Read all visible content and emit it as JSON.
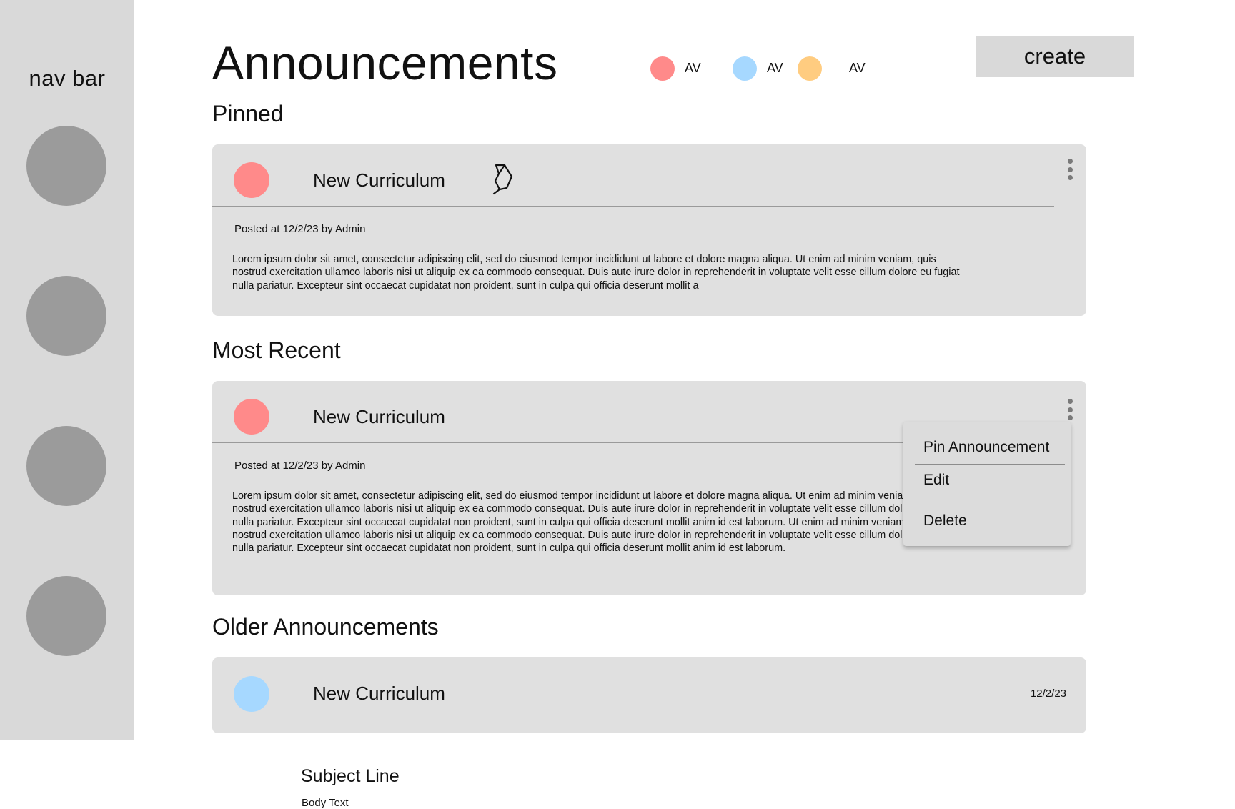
{
  "sidebar": {
    "title": "nav bar"
  },
  "header": {
    "title": "Announcements",
    "avatars": [
      {
        "label": "AV",
        "color": "#ff8a8a"
      },
      {
        "label": "AV",
        "color": "#a6d8ff"
      },
      {
        "label": "AV",
        "color": "#ffcc80"
      }
    ],
    "create_label": "create"
  },
  "sections": {
    "pinned": "Pinned",
    "recent": "Most Recent",
    "older": "Older Announcements"
  },
  "pinned_card": {
    "title": "New Curriculum",
    "meta": "Posted at 12/2/23 by Admin",
    "body": "Lorem ipsum dolor sit amet, consectetur adipiscing elit, sed do eiusmod tempor incididunt ut labore et dolore magna aliqua. Ut enim ad minim veniam, quis nostrud exercitation ullamco laboris nisi ut aliquip ex ea commodo consequat. Duis aute irure dolor in reprehenderit in voluptate velit esse cillum dolore eu fugiat nulla pariatur. Excepteur sint occaecat cupidatat non proident, sunt in culpa qui officia deserunt mollit a",
    "dot_color": "#ff8a8a",
    "icon": "pin-icon"
  },
  "recent_card": {
    "title": "New Curriculum",
    "meta": "Posted at 12/2/23 by Admin",
    "body": "Lorem ipsum dolor sit amet, consectetur adipiscing elit, sed do eiusmod tempor incididunt ut labore et dolore magna aliqua. Ut enim ad minim veniam, quis nostrud exercitation ullamco laboris nisi ut aliquip ex ea commodo consequat. Duis aute irure dolor in reprehenderit in voluptate velit esse cillum dolore eu fugiat nulla pariatur. Excepteur sint occaecat cupidatat non proident, sunt in culpa qui officia deserunt mollit anim id est laborum. Ut enim ad minim veniam, quis nostrud exercitation ullamco laboris nisi ut aliquip ex ea commodo consequat. Duis aute irure dolor in reprehenderit in voluptate velit esse cillum dolore eu fugiat nulla pariatur. Excepteur sint occaecat cupidatat non proident, sunt in culpa qui officia deserunt mollit anim id est laborum.",
    "dot_color": "#ff8a8a"
  },
  "context_menu": {
    "items": [
      "Pin Announcement",
      "Edit",
      "Delete"
    ]
  },
  "older_card": {
    "title": "New Curriculum",
    "date": "12/2/23",
    "dot_color": "#a6d8ff"
  },
  "preview": {
    "subject": "Subject Line",
    "body": "Body Text"
  }
}
